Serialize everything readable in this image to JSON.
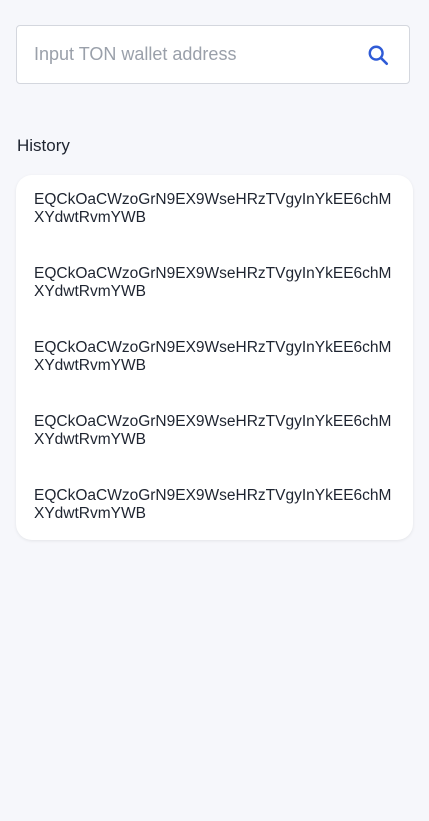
{
  "search": {
    "placeholder": "Input TON wallet address",
    "value": "",
    "icon": "search-icon",
    "icon_color": "#2f5bd6"
  },
  "history": {
    "title": "History",
    "items": [
      {
        "address": "EQCkOaCWzoGrN9EX9WseHRzTVgyInYkEE6chMXYdwtRvmYWB"
      },
      {
        "address": "EQCkOaCWzoGrN9EX9WseHRzTVgyInYkEE6chMXYdwtRvmYWB"
      },
      {
        "address": "EQCkOaCWzoGrN9EX9WseHRzTVgyInYkEE6chMXYdwtRvmYWB"
      },
      {
        "address": "EQCkOaCWzoGrN9EX9WseHRzTVgyInYkEE6chMXYdwtRvmYWB"
      },
      {
        "address": "EQCkOaCWzoGrN9EX9WseHRzTVgyInYkEE6chMXYdwtRvmYWB"
      }
    ]
  }
}
